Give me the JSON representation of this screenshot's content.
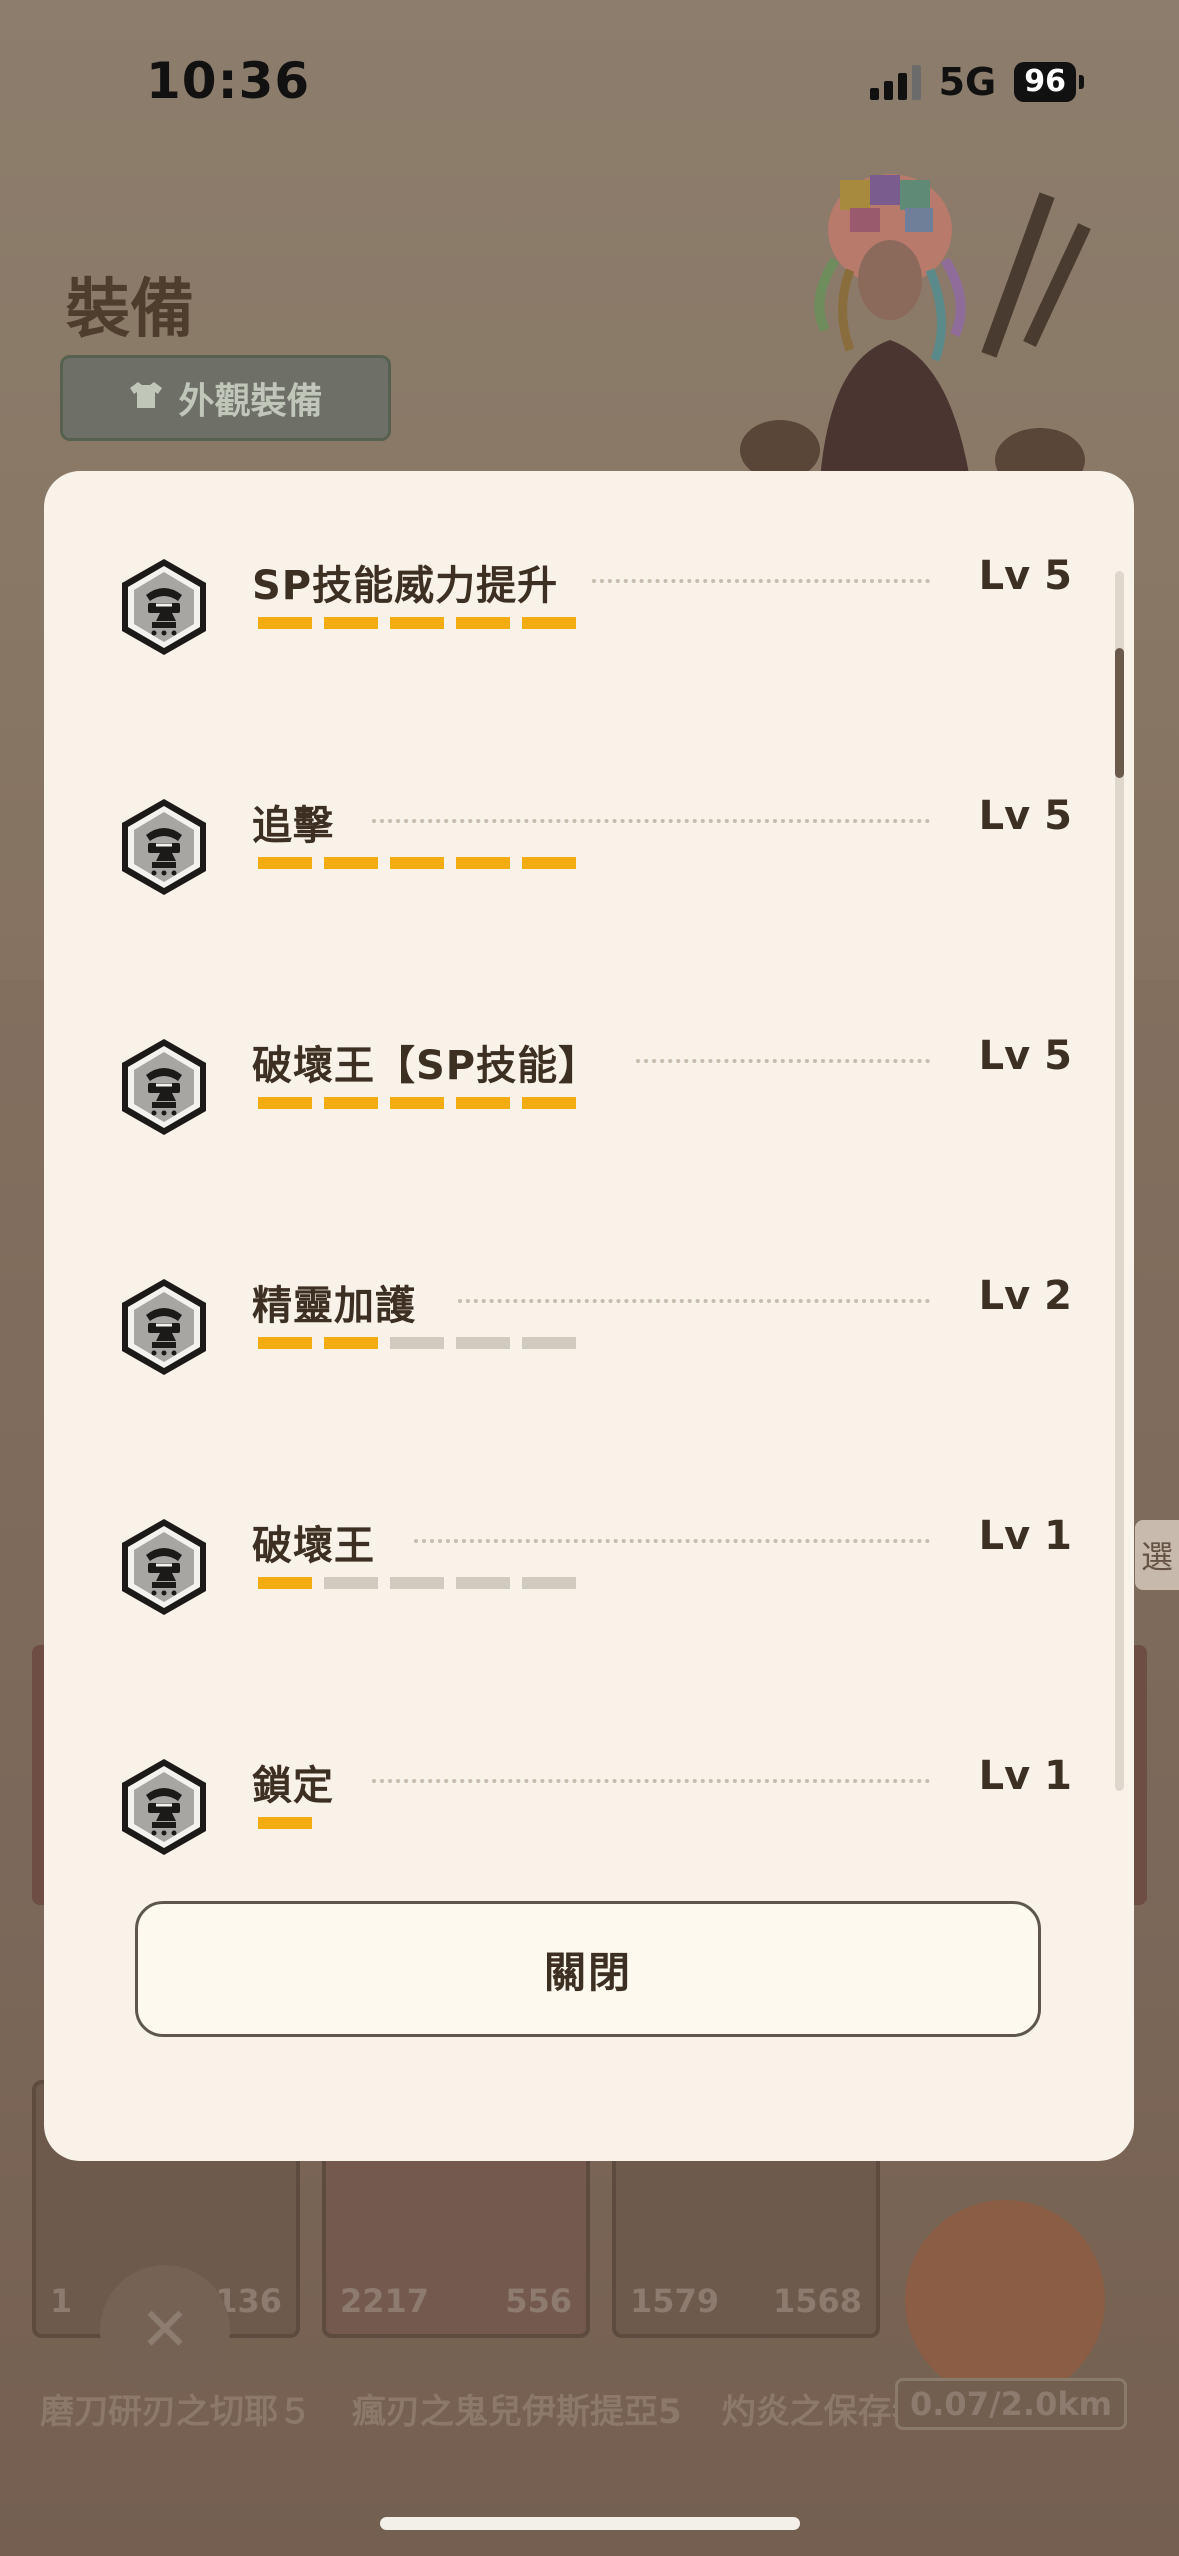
{
  "status_bar": {
    "time": "10:36",
    "network": "5G",
    "battery": "96"
  },
  "background": {
    "title": "裝備",
    "skin_button": "外觀裝備",
    "side_tab": "選",
    "cards": [
      {
        "stat_left": "1",
        "stat_right": "136",
        "name": "磨刀研刃之切耶５"
      },
      {
        "stat_left": "2217",
        "stat_right": "556",
        "name": "瘋刃之鬼兒伊斯提亞5"
      },
      {
        "stat_left": "1579",
        "stat_right": "1568",
        "name": "灼炎之保存者改５"
      }
    ],
    "distance": "0.07/2.0km"
  },
  "modal": {
    "skills": [
      {
        "name": "SP技能威力提升",
        "level": "Lv 5",
        "filled": 5,
        "total": 5
      },
      {
        "name": "追擊",
        "level": "Lv 5",
        "filled": 5,
        "total": 5
      },
      {
        "name": "破壞王【SP技能】",
        "level": "Lv 5",
        "filled": 5,
        "total": 5
      },
      {
        "name": "精靈加護",
        "level": "Lv 2",
        "filled": 2,
        "total": 5
      },
      {
        "name": "破壞王",
        "level": "Lv 1",
        "filled": 1,
        "total": 5
      },
      {
        "name": "鎖定",
        "level": "Lv 1",
        "filled": 1,
        "total": 1
      }
    ],
    "close_label": "關閉"
  },
  "colors": {
    "accent": "#f4ac13",
    "modal_bg": "#f9f2e8",
    "text": "#3e2f23"
  }
}
